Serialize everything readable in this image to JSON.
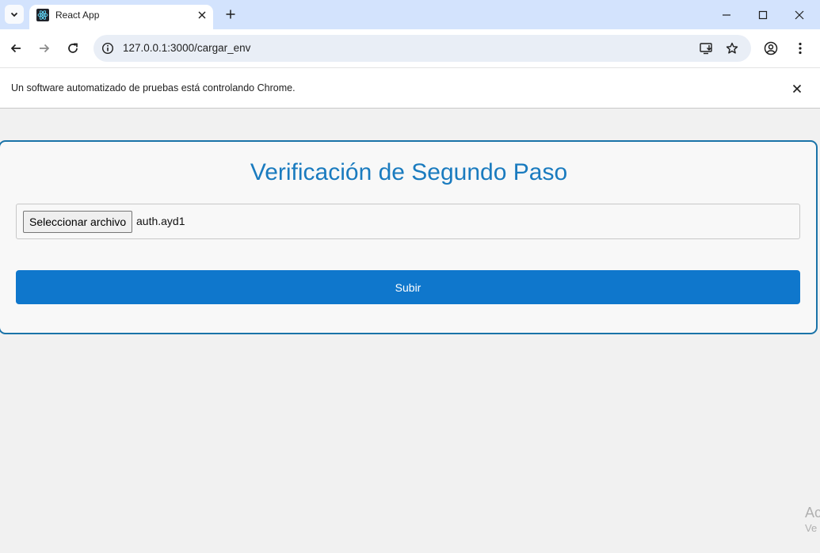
{
  "browser": {
    "tab_title": "React App",
    "url": "127.0.0.1:3000/cargar_env",
    "infobar_message": "Un software automatizado de pruebas está controlando Chrome."
  },
  "page": {
    "title": "Verificación de Segundo Paso",
    "file_button_label": "Seleccionar archivo",
    "file_name": "auth.ayd1",
    "submit_label": "Subir"
  },
  "watermark": {
    "line1": "Ac",
    "line2": "Ve"
  },
  "colors": {
    "accent": "#0f77cc",
    "title": "#1a7bbf",
    "card_border": "#1a73a8",
    "tabstrip": "#d3e3fd"
  }
}
